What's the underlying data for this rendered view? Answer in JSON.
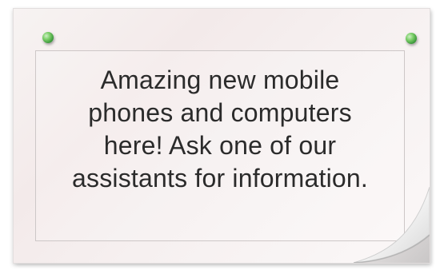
{
  "note": {
    "lines": [
      "Amazing new mobile",
      "phones and computers",
      "here! Ask one of our",
      "assistants for information."
    ]
  },
  "colors": {
    "paper": "#f6f0f0",
    "pin": "#4caf50",
    "text": "#2b2b2b"
  },
  "icons": {
    "left_pin": "pushpin-icon",
    "right_pin": "pushpin-icon"
  }
}
